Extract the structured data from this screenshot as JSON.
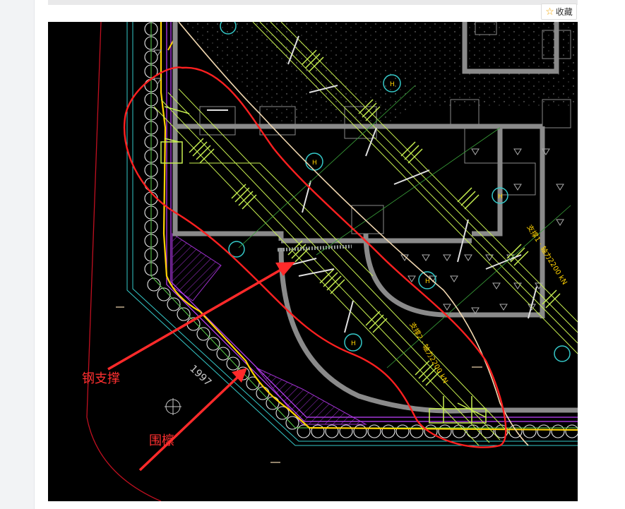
{
  "toolbar": {
    "favorite_label": "收藏",
    "favorite_icon": "star-icon"
  },
  "drawing": {
    "annotation_steel_support": "钢支撑",
    "annotation_waler": "围檩",
    "dimension_text": "1997",
    "strut_label_1": "支撑1 · 轴力2200 kN",
    "strut_label_2": "支撑2 · 轴力2200 kN"
  },
  "colors": {
    "background": "#000000",
    "markup_red": "#ff2020",
    "strut_green": "#c8f050",
    "pile_white": "#e8e8e8",
    "wall_gray": "#8a8a8a",
    "waler_yellow": "#ffd200",
    "cyan_line": "#35c8c8",
    "magenta_line": "#c040ff"
  }
}
